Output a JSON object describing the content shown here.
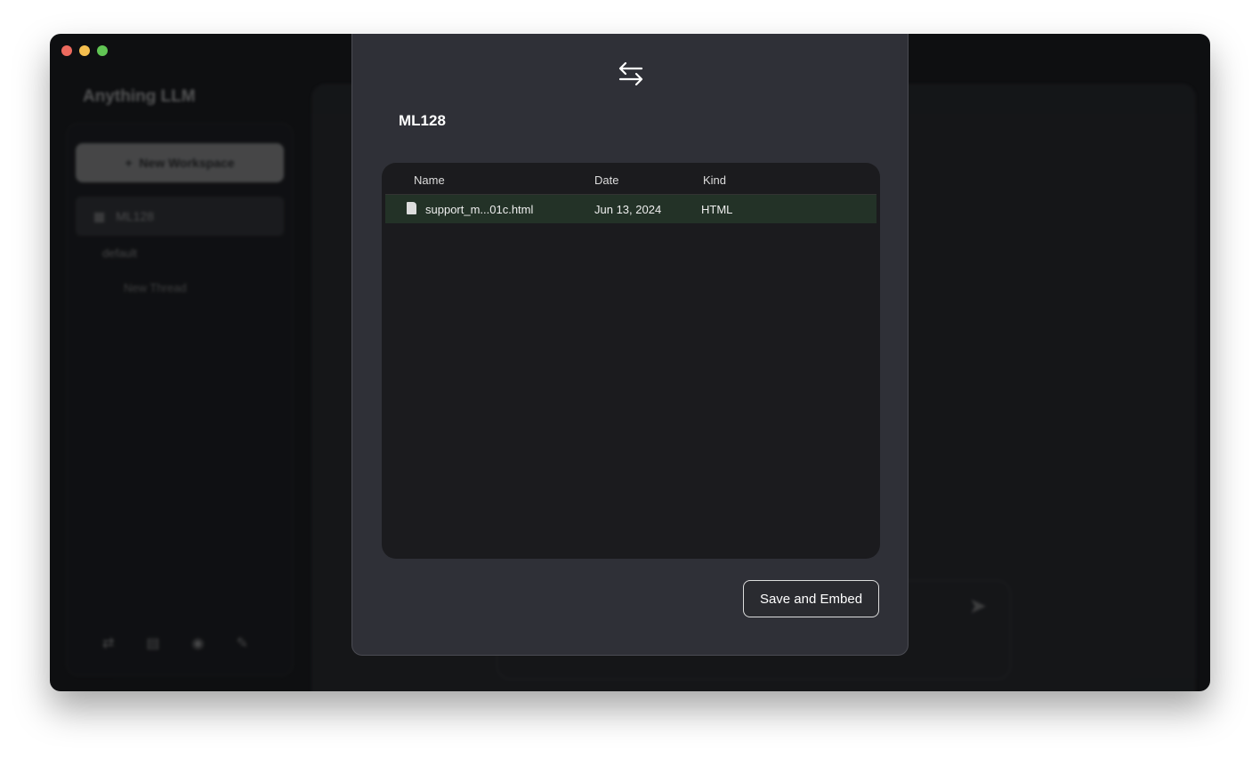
{
  "app": {
    "logo": "Anything LLM"
  },
  "sidebar": {
    "new_workspace": "New Workspace",
    "workspace": "ML128",
    "thread": "default",
    "new_thread": "New Thread"
  },
  "modal": {
    "title": "ML128",
    "columns": [
      "Name",
      "Date",
      "Kind"
    ],
    "files": [
      {
        "name": "support_m...01c.html",
        "date": "Jun 13, 2024",
        "kind": "HTML"
      }
    ],
    "save_button": "Save and Embed"
  },
  "colors": {
    "selected_row": "#233227",
    "modal_bg": "#2f3037",
    "panel_bg": "#1b1b1e"
  }
}
